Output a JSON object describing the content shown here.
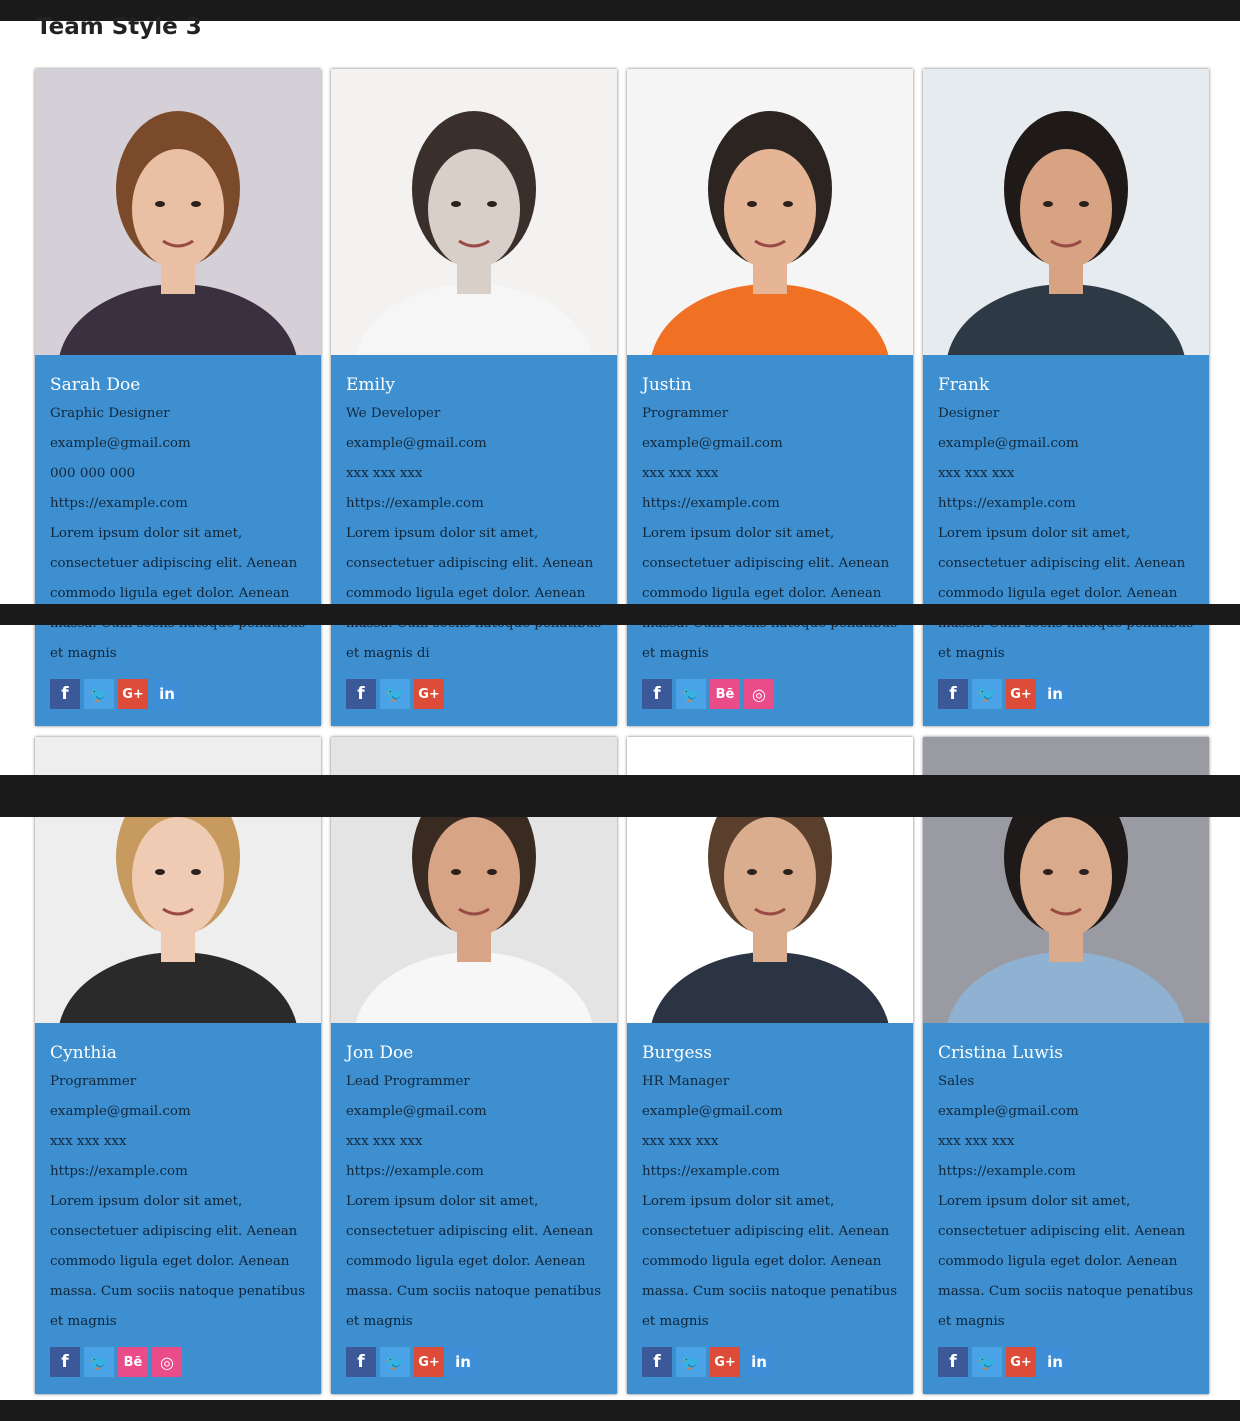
{
  "page": {
    "title": "Team Style 3"
  },
  "members": [
    {
      "name": "Sarah Doe",
      "role": "Graphic Designer",
      "email": "example@gmail.com",
      "phone": "000 000 000",
      "website": "https://example.com",
      "bio": "Lorem ipsum dolor sit amet, consectetuer adipiscing elit. Aenean commodo ligula eget dolor. Aenean massa. Cum sociis natoque penatibus et magnis",
      "photo": {
        "bg": "#d5d0d8",
        "skin": "#e9c0a3",
        "hair": "#7a4a2a",
        "shirt": "#3a3040"
      },
      "socials": [
        {
          "icon": "facebook-icon",
          "glyph": "f"
        },
        {
          "icon": "twitter-icon",
          "glyph": "🐦"
        },
        {
          "icon": "google-plus-icon",
          "glyph": "G+"
        },
        {
          "icon": "linkedin-icon",
          "glyph": "in"
        }
      ]
    },
    {
      "name": "Emily",
      "role": "We Developer",
      "email": "example@gmail.com",
      "phone": "xxx xxx xxx",
      "website": "https://example.com",
      "bio": "Lorem ipsum dolor sit amet, consectetuer adipiscing elit. Aenean commodo ligula eget dolor. Aenean massa. Cum sociis natoque penatibus et magnis di",
      "photo": {
        "bg": "#f4f2f1",
        "skin": "#d9cfc9",
        "hair": "#3a2f2a",
        "shirt": "#f6f6f6"
      },
      "socials": [
        {
          "icon": "facebook-icon",
          "glyph": "f"
        },
        {
          "icon": "twitter-icon",
          "glyph": "🐦"
        },
        {
          "icon": "google-plus-icon",
          "glyph": "G+"
        }
      ]
    },
    {
      "name": "Justin",
      "role": "Programmer",
      "email": "example@gmail.com",
      "phone": "xxx xxx xxx",
      "website": "https://example.com",
      "bio": "Lorem ipsum dolor sit amet, consectetuer adipiscing elit. Aenean commodo ligula eget dolor. Aenean massa. Cum sociis natoque penatibus et magnis",
      "photo": {
        "bg": "#f5f5f5",
        "skin": "#e5b596",
        "hair": "#2b2420",
        "shirt": "#f07124"
      },
      "socials": [
        {
          "icon": "facebook-icon",
          "glyph": "f"
        },
        {
          "icon": "twitter-icon",
          "glyph": "🐦"
        },
        {
          "icon": "behance-icon",
          "glyph": "Bē"
        },
        {
          "icon": "dribbble-icon",
          "glyph": "◎"
        }
      ]
    },
    {
      "name": "Frank",
      "role": "Designer",
      "email": "example@gmail.com",
      "phone": "xxx xxx xxx",
      "website": "https://example.com",
      "bio": "Lorem ipsum dolor sit amet, consectetuer adipiscing elit. Aenean commodo ligula eget dolor. Aenean massa. Cum sociis natoque penatibus et magnis",
      "photo": {
        "bg": "#e6ebef",
        "skin": "#d7a382",
        "hair": "#1f1a18",
        "shirt": "#2d3a46"
      },
      "socials": [
        {
          "icon": "facebook-icon",
          "glyph": "f"
        },
        {
          "icon": "twitter-icon",
          "glyph": "🐦"
        },
        {
          "icon": "google-plus-icon",
          "glyph": "G+"
        },
        {
          "icon": "linkedin-icon",
          "glyph": "in"
        }
      ]
    },
    {
      "name": "Cynthia",
      "role": "Programmer",
      "email": "example@gmail.com",
      "phone": "xxx xxx xxx",
      "website": "https://example.com",
      "bio": "Lorem ipsum dolor sit amet, consectetuer adipiscing elit. Aenean commodo ligula eget dolor. Aenean massa. Cum sociis natoque penatibus et magnis",
      "photo": {
        "bg": "#eeeeee",
        "skin": "#f0cbb3",
        "hair": "#c79a5f",
        "shirt": "#2a2a2a"
      },
      "socials": [
        {
          "icon": "facebook-icon",
          "glyph": "f"
        },
        {
          "icon": "twitter-icon",
          "glyph": "🐦"
        },
        {
          "icon": "behance-icon",
          "glyph": "Bē"
        },
        {
          "icon": "dribbble-icon",
          "glyph": "◎"
        }
      ]
    },
    {
      "name": "Jon Doe",
      "role": "Lead Programmer",
      "email": "example@gmail.com",
      "phone": "xxx xxx xxx",
      "website": "https://example.com",
      "bio": "Lorem ipsum dolor sit amet, consectetuer adipiscing elit. Aenean commodo ligula eget dolor. Aenean massa. Cum sociis natoque penatibus et magnis",
      "photo": {
        "bg": "#e4e4e4",
        "skin": "#d8a486",
        "hair": "#3a2b22",
        "shirt": "#f7f7f7"
      },
      "socials": [
        {
          "icon": "facebook-icon",
          "glyph": "f"
        },
        {
          "icon": "twitter-icon",
          "glyph": "🐦"
        },
        {
          "icon": "google-plus-icon",
          "glyph": "G+"
        },
        {
          "icon": "linkedin-icon",
          "glyph": "in"
        }
      ]
    },
    {
      "name": "Burgess",
      "role": "HR Manager",
      "email": "example@gmail.com",
      "phone": "xxx xxx xxx",
      "website": "https://example.com",
      "bio": "Lorem ipsum dolor sit amet, consectetuer adipiscing elit. Aenean commodo ligula eget dolor. Aenean massa. Cum sociis natoque penatibus et magnis",
      "photo": {
        "bg": "#ffffff",
        "skin": "#d9ad8d",
        "hair": "#5a402c",
        "shirt": "#2a3442"
      },
      "socials": [
        {
          "icon": "facebook-icon",
          "glyph": "f"
        },
        {
          "icon": "twitter-icon",
          "glyph": "🐦"
        },
        {
          "icon": "google-plus-icon",
          "glyph": "G+"
        },
        {
          "icon": "linkedin-icon",
          "glyph": "in"
        }
      ]
    },
    {
      "name": "Cristina Luwis",
      "role": "Sales",
      "email": "example@gmail.com",
      "phone": "xxx xxx xxx",
      "website": "https://example.com",
      "bio": "Lorem ipsum dolor sit amet, consectetuer adipiscing elit. Aenean commodo ligula eget dolor. Aenean massa. Cum sociis natoque penatibus et magnis",
      "photo": {
        "bg": "#9a9ba2",
        "skin": "#d9aa8c",
        "hair": "#1e1a19",
        "shirt": "#8fb1d2"
      },
      "socials": [
        {
          "icon": "facebook-icon",
          "glyph": "f"
        },
        {
          "icon": "twitter-icon",
          "glyph": "🐦"
        },
        {
          "icon": "google-plus-icon",
          "glyph": "G+"
        },
        {
          "icon": "linkedin-icon",
          "glyph": "in"
        }
      ]
    }
  ]
}
